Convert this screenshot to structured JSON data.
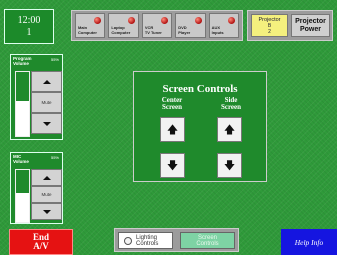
{
  "clock": {
    "time": "12:00",
    "day": "1"
  },
  "sources": [
    {
      "line1": "Main",
      "line2": "Computer"
    },
    {
      "line1": "Laptop",
      "line2": "Computer"
    },
    {
      "line1": "VCR",
      "line2": "TV Tuner"
    },
    {
      "line1": "DVD",
      "line2": "Player"
    },
    {
      "line1": "AUX",
      "line2": "Inputs"
    }
  ],
  "projector": {
    "select_line1": "Projector",
    "select_line2": "B",
    "select_line3": "2",
    "power_line1": "Projector",
    "power_line2": "Power"
  },
  "program_volume": {
    "title_line1": "Program",
    "title_line2": "Volume",
    "percent": "55%",
    "level": 0.55,
    "mute_label": "Mute"
  },
  "mic_volume": {
    "title_line1": "MIC",
    "title_line2": "Volume",
    "percent": "55%",
    "level": 0.55,
    "mute_label": "Mute"
  },
  "screen_controls": {
    "title": "Screen Controls",
    "center_line1": "Center",
    "center_line2": "Screen",
    "side_line1": "Side",
    "side_line2": "Screen"
  },
  "bottom": {
    "end_line1": "End",
    "end_line2": "A/V",
    "lighting_line1": "Lighting",
    "lighting_line2": "Controls",
    "screen_line1": "Screen",
    "screen_line2": "Controls",
    "help": "Help Info"
  },
  "icons": {
    "up": "up-arrow-icon",
    "down": "down-arrow-icon",
    "bulb": "lightbulb-icon"
  },
  "colors": {
    "background": "#2f9a3a",
    "end_button": "#e51212",
    "help_button": "#1515e0",
    "projector_selected": "#f4f07e"
  }
}
